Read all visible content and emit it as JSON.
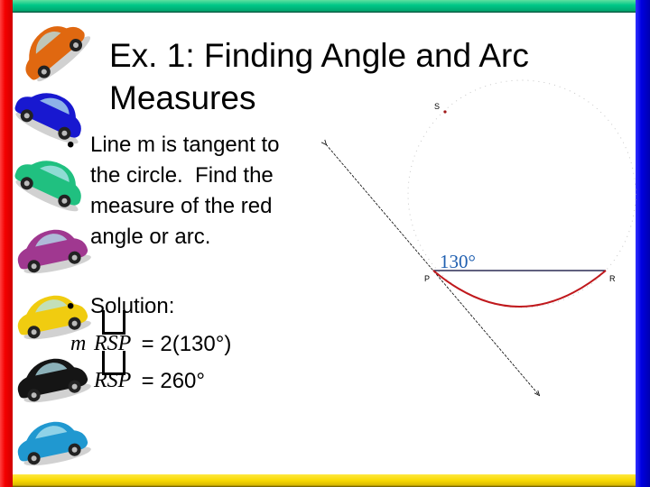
{
  "slide": {
    "title_line1": "Ex. 1:  Finding Angle and Arc",
    "title_line2": "Measures",
    "bullets": [
      {
        "marker": "•",
        "text": "Line m is tangent to\nthe circle.  Find the\nmeasure of the red\nangle or arc."
      },
      {
        "marker": "•",
        "text": "Solution:"
      }
    ],
    "equations": [
      {
        "prefix": "m",
        "arc": "RSP",
        "rhs": " = 2(130°)"
      },
      {
        "prefix": "",
        "arc": "RSP",
        "rhs": " = 260°"
      }
    ]
  },
  "diagram": {
    "angle_label": "130°",
    "points": {
      "S": "S",
      "P": "P",
      "R": "R"
    },
    "colors": {
      "arc": "#c0181c",
      "label": "#1f5fb0",
      "chord": "#000033",
      "tangent": "#000000"
    }
  },
  "decor": {
    "frame_colors": {
      "left": "#f40000",
      "right": "#0000e0",
      "top": "#00c888",
      "bottom": "#f8d800"
    },
    "cars": [
      {
        "name": "orange-car",
        "color": "#e06810"
      },
      {
        "name": "blue-car",
        "color": "#1818d0"
      },
      {
        "name": "green-car",
        "color": "#20c080"
      },
      {
        "name": "purple-car",
        "color": "#a03890"
      },
      {
        "name": "yellow-car",
        "color": "#f0cc10"
      },
      {
        "name": "black-car",
        "color": "#151515"
      },
      {
        "name": "lightblue-car",
        "color": "#2098d0"
      }
    ]
  }
}
